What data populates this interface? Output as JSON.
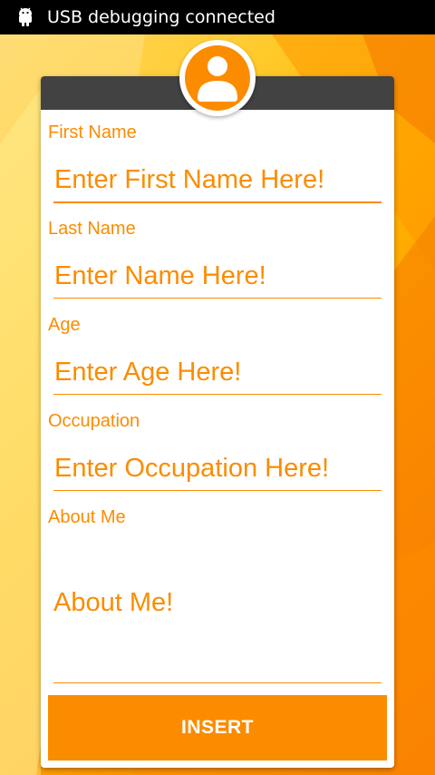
{
  "status_bar": {
    "icon": "android-debug-icon",
    "text": "USB debugging connected"
  },
  "form": {
    "avatar_icon": "user-avatar-icon",
    "fields": [
      {
        "label": "First Name",
        "placeholder": "Enter First Name Here!"
      },
      {
        "label": "Last Name",
        "placeholder": "Enter Name Here!"
      },
      {
        "label": "Age",
        "placeholder": "Enter Age Here!"
      },
      {
        "label": "Occupation",
        "placeholder": "Enter Occupation Here!"
      }
    ],
    "about": {
      "label": "About Me",
      "placeholder": "About Me!"
    },
    "submit_label": "INSERT"
  },
  "colors": {
    "accent": "#fb8c00",
    "header": "#424242",
    "status_bar": "#000000"
  }
}
